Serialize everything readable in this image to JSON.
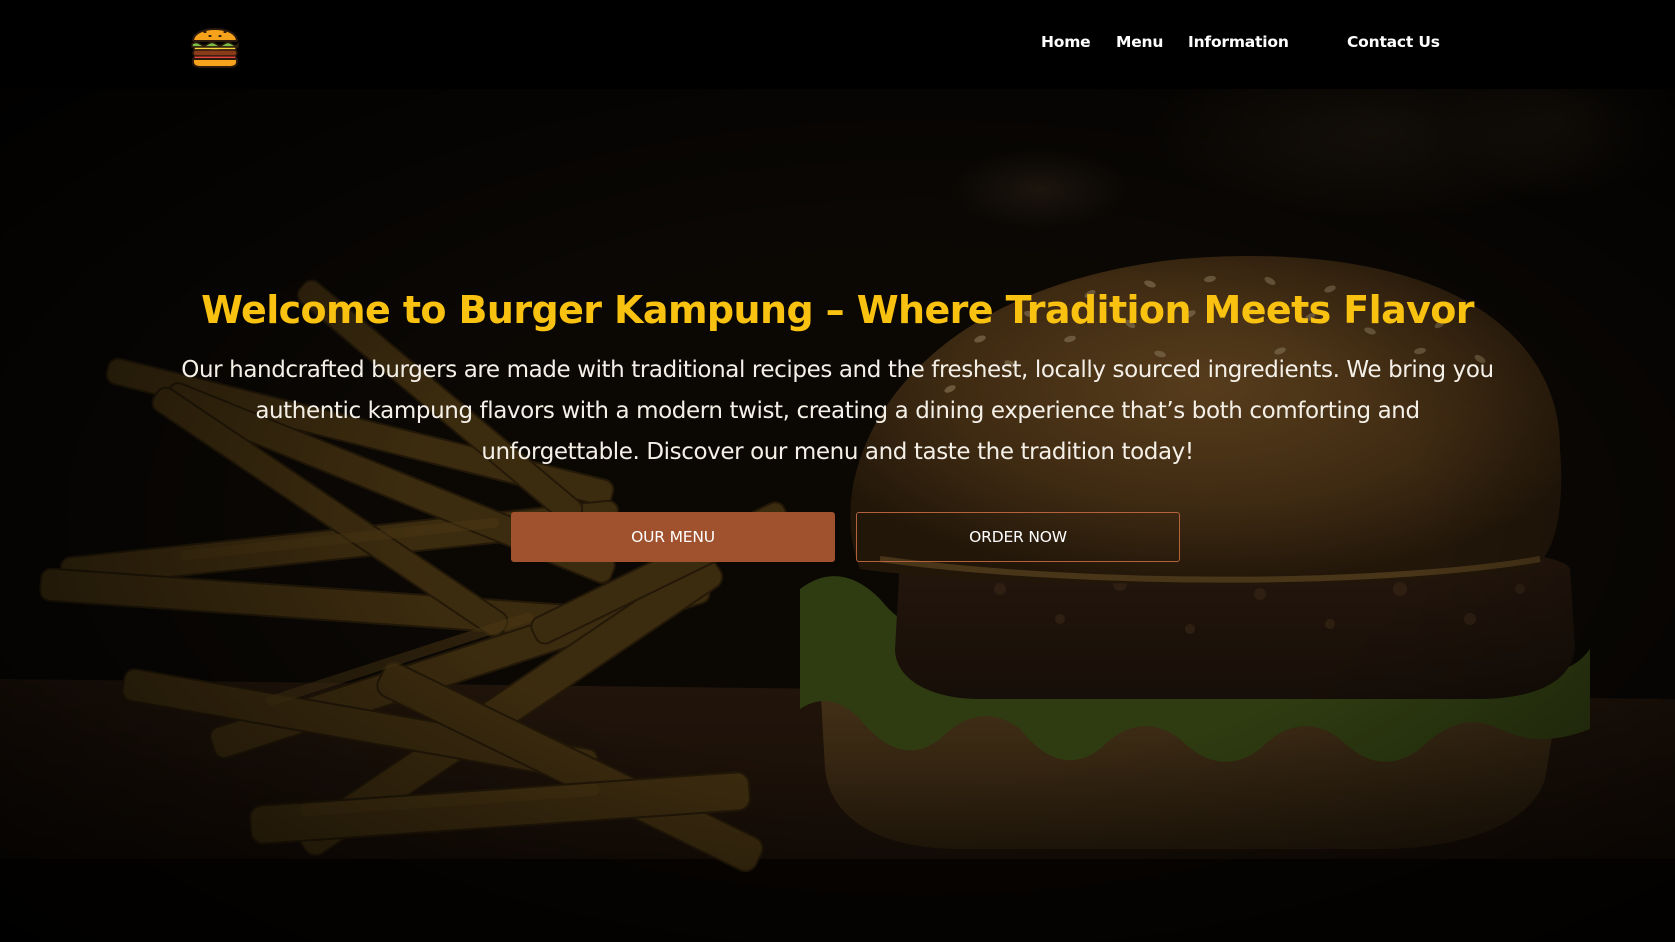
{
  "nav": {
    "logo_icon": "burger-icon",
    "links": [
      {
        "label": "Home"
      },
      {
        "label": "Menu"
      },
      {
        "label": "Information"
      },
      {
        "label": "Contact Us"
      }
    ]
  },
  "hero": {
    "title": "Welcome to Burger Kampung – Where Tradition Meets Flavor",
    "description": "Our handcrafted burgers are made with traditional recipes and the freshest, locally sourced ingredients. We bring you authentic kampung flavors with a modern twist, creating a dining experience that’s both comforting and unforgettable. Discover our menu and taste the tradition today!",
    "primary_button": "OUR MENU",
    "secondary_button": "ORDER NOW"
  },
  "colors": {
    "title": "#f9c211",
    "primary_button": "#a0512e",
    "navbar_background": "#000000"
  }
}
